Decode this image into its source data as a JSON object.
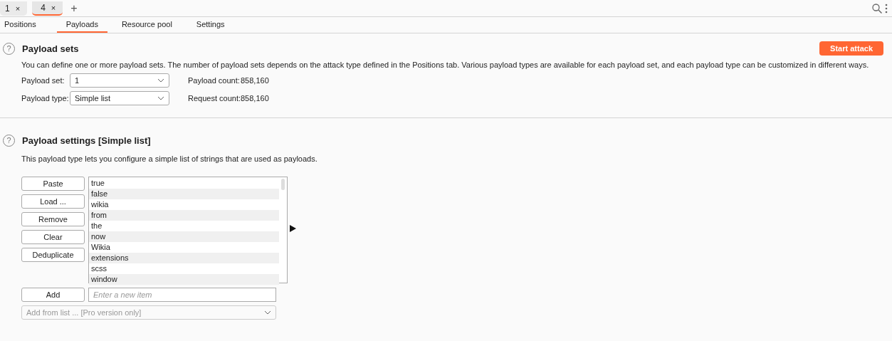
{
  "top_tabs": [
    {
      "label": "1",
      "close": "×",
      "selected": false
    },
    {
      "label": "4",
      "close": "×",
      "selected": true
    }
  ],
  "new_tab": "+",
  "sub_tabs": [
    {
      "label": "Positions",
      "selected": false
    },
    {
      "label": "Payloads",
      "selected": true
    },
    {
      "label": "Resource pool",
      "selected": false
    },
    {
      "label": "Settings",
      "selected": false
    }
  ],
  "payload_sets": {
    "title": "Payload sets",
    "help": "?",
    "description": "You can define one or more payload sets. The number of payload sets depends on the attack type defined in the Positions tab. Various payload types are available for each payload set, and each payload type can be customized in different ways.",
    "start_button": "Start attack",
    "fields": [
      {
        "label": "Payload set:",
        "value": "1",
        "stat_label": "Payload count:",
        "stat_value": "858,160"
      },
      {
        "label": "Payload type:",
        "value": "Simple list",
        "stat_label": "Request count:",
        "stat_value": "858,160"
      }
    ]
  },
  "payload_settings": {
    "title": "Payload settings [Simple list]",
    "help": "?",
    "description": "This payload type lets you configure a simple list of strings that are used as payloads.",
    "buttons": [
      "Paste",
      "Load ...",
      "Remove",
      "Clear",
      "Deduplicate"
    ],
    "items": [
      "true",
      "false",
      "wikia",
      "from",
      "the",
      "now",
      "Wikia",
      "extensions",
      "scss",
      "window"
    ],
    "add_button": "Add",
    "add_placeholder": "Enter a new item",
    "add_from_list": {
      "value": "Add from list ... [Pro version only]",
      "disabled": true
    }
  }
}
